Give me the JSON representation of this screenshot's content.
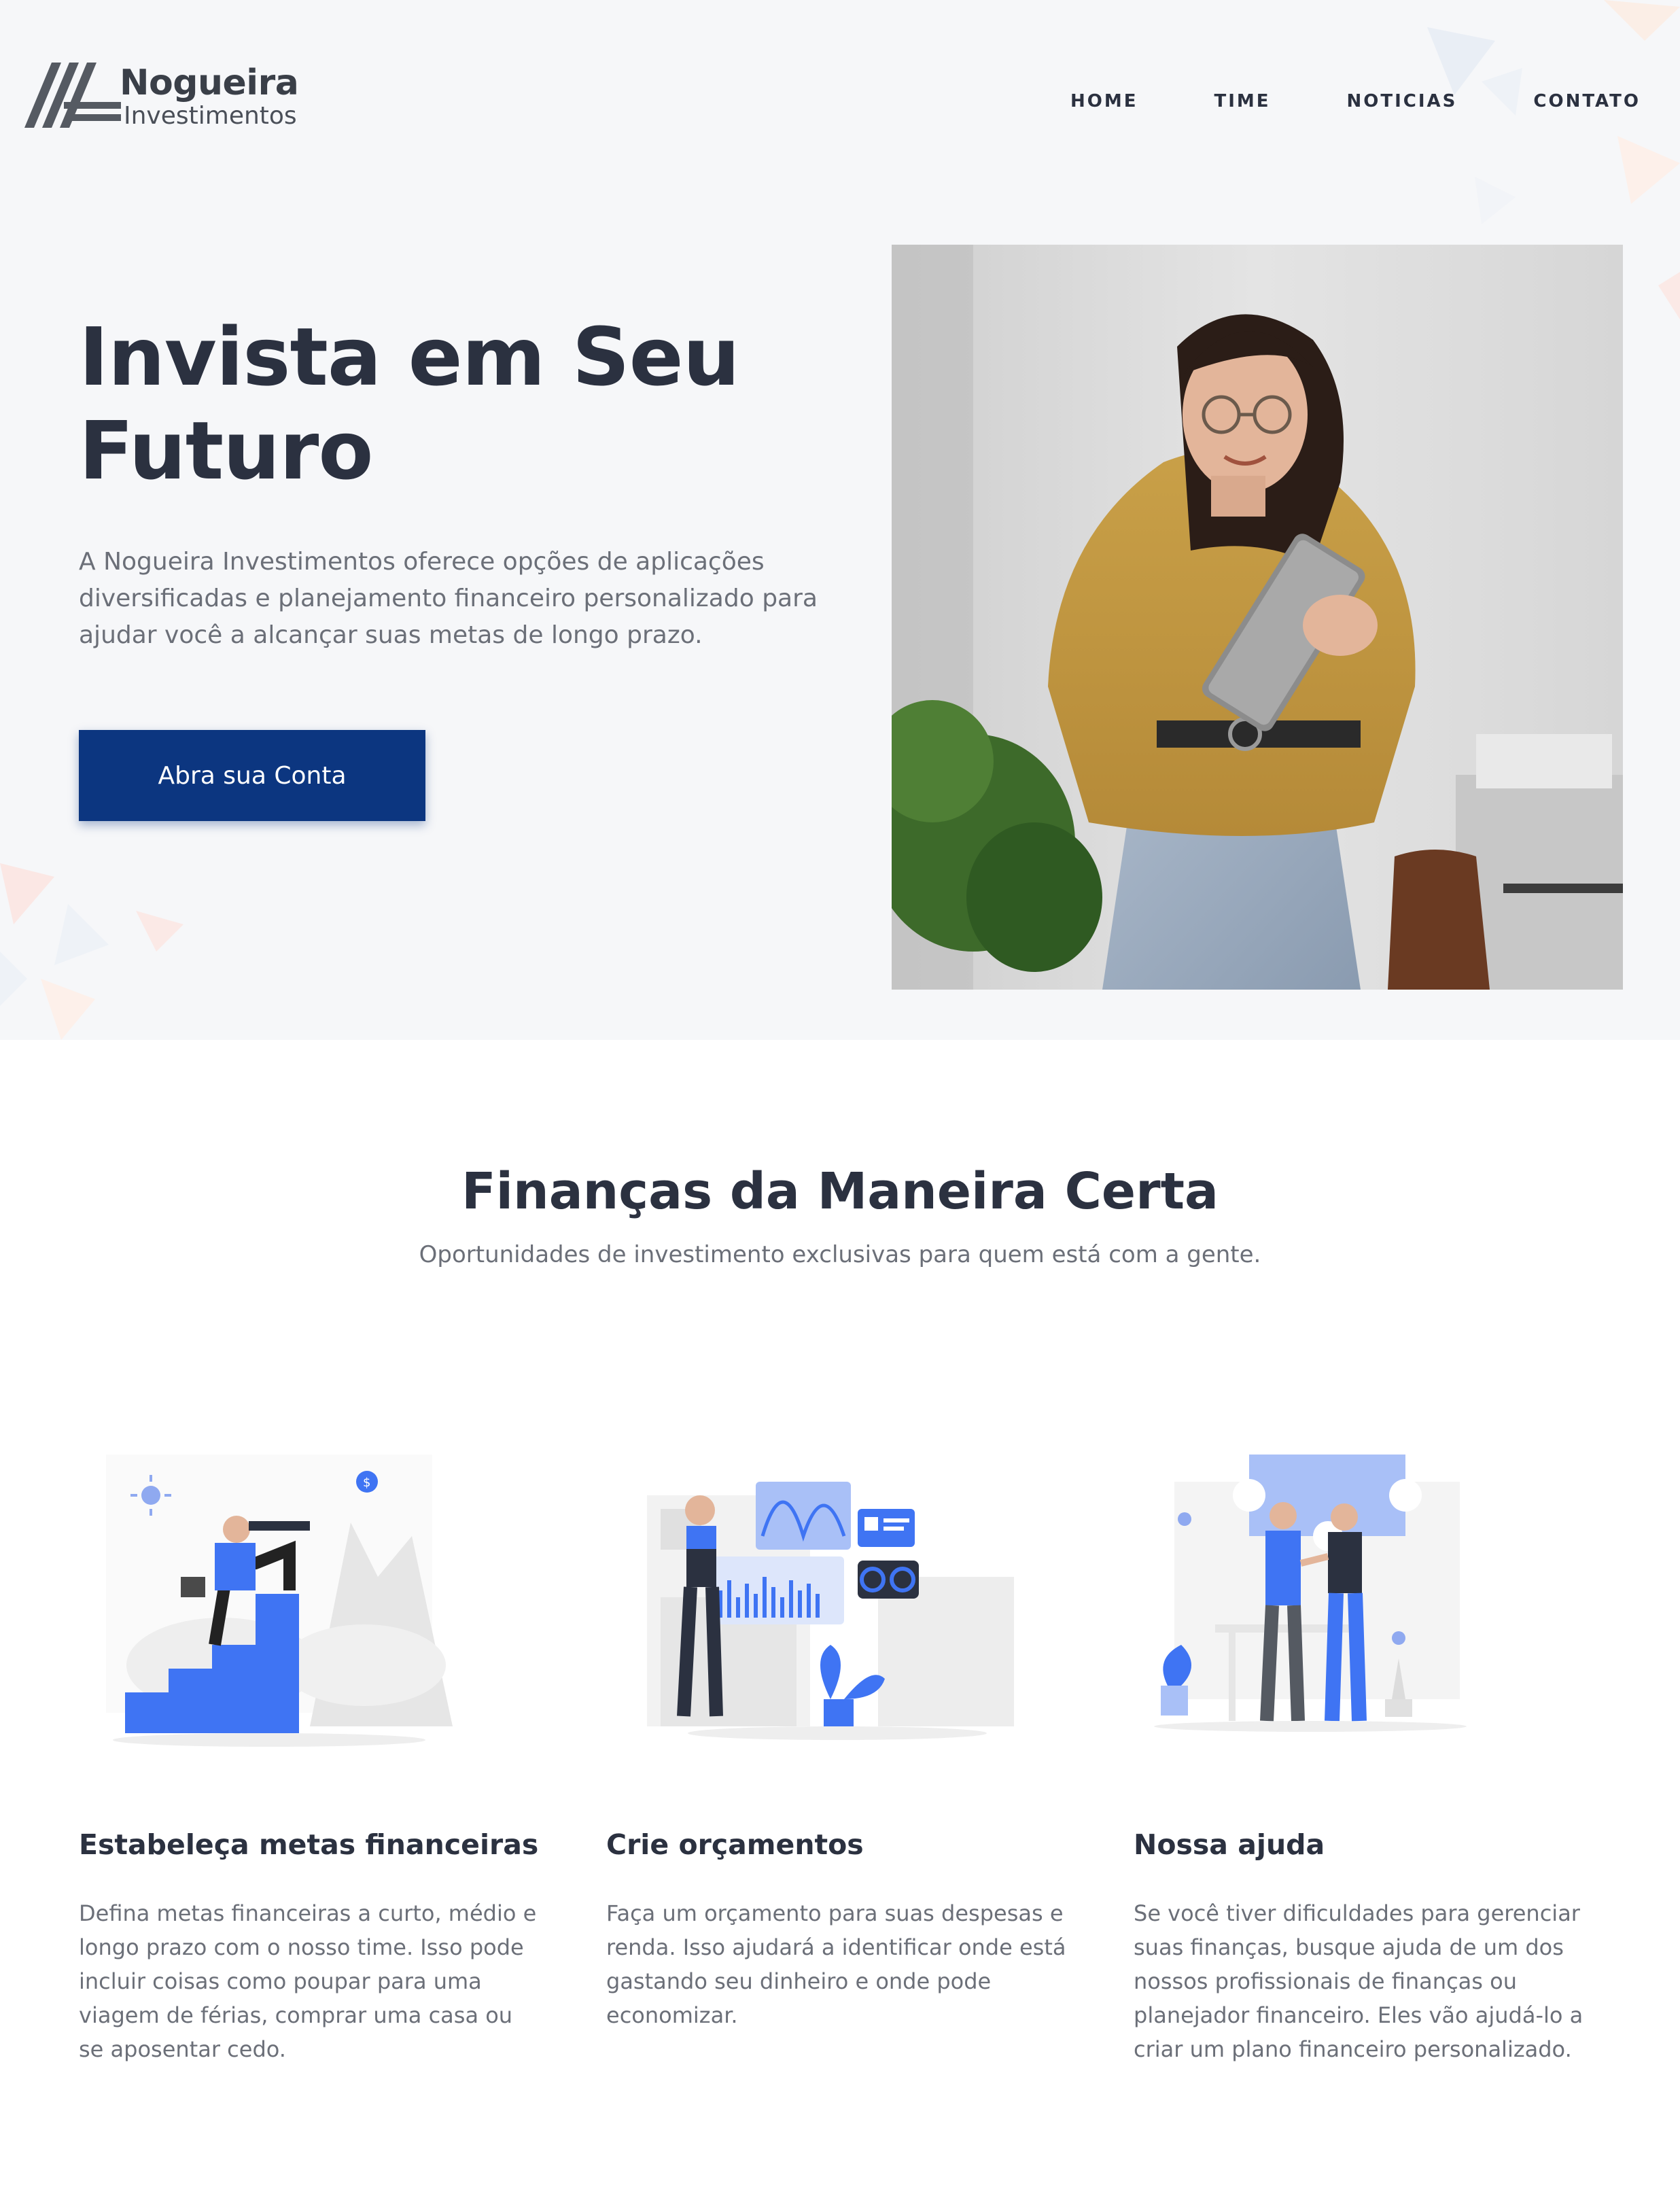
{
  "brand": {
    "name": "Nogueira",
    "subtitle": "Investimentos"
  },
  "nav": {
    "items": [
      "HOME",
      "TIME",
      "NOTICIAS",
      "CONTATO"
    ]
  },
  "hero": {
    "title": "Invista em Seu Futuro",
    "description": "A Nogueira Investimentos oferece opções de aplicações diversificadas e planejamento financeiro personalizado para ajudar você a alcançar suas metas de longo prazo.",
    "cta_label": "Abra sua Conta"
  },
  "section": {
    "title": "Finanças da Maneira Certa",
    "subtitle": "Oportunidades de investimento exclusivas para quem está com a gente."
  },
  "features": [
    {
      "title": "Estabeleça metas financeiras",
      "text": "Defina metas financeiras a curto, médio e longo prazo com o nosso time. Isso pode incluir coisas como poupar para uma viagem de férias, comprar uma casa ou se aposentar cedo."
    },
    {
      "title": "Crie orçamentos",
      "text": "Faça um orçamento para suas despesas e renda. Isso ajudará a identificar onde está gastando seu dinheiro e onde pode economizar."
    },
    {
      "title": "Nossa ajuda",
      "text": "Se você tiver dificuldades para gerenciar suas finanças, busque ajuda de um dos nossos profissionais de finanças ou planejador financeiro. Eles vão ajudá-lo a criar um plano financeiro personalizado."
    }
  ],
  "colors": {
    "accent": "#0c3680",
    "illustration_blue": "#3f74f3",
    "heading": "#2b3140",
    "body_text": "#6b6f78",
    "hero_bg": "#f6f7f9"
  }
}
